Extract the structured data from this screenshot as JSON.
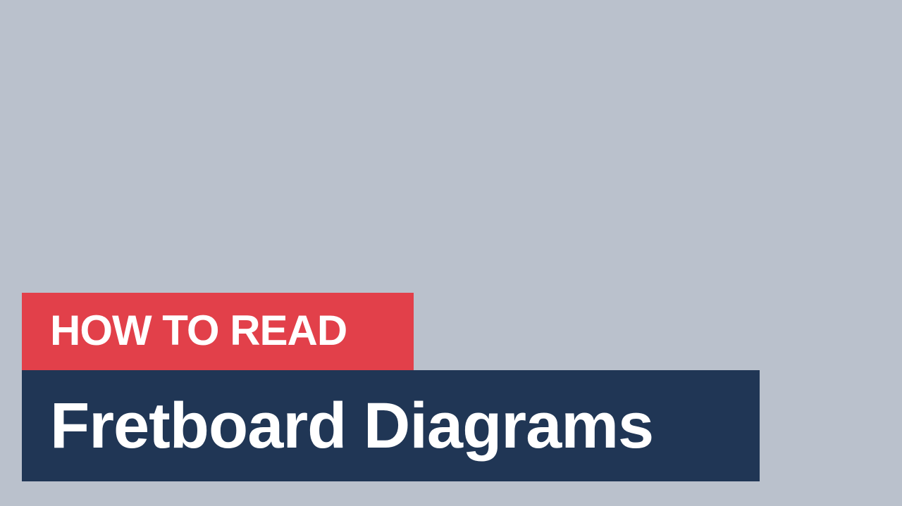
{
  "title_card": {
    "kicker": "HOW TO READ",
    "headline": "Fretboard Diagrams"
  },
  "colors": {
    "background": "#bac1cc",
    "kicker_bar": "#e2404a",
    "headline_bar": "#203655",
    "text": "#ffffff"
  }
}
